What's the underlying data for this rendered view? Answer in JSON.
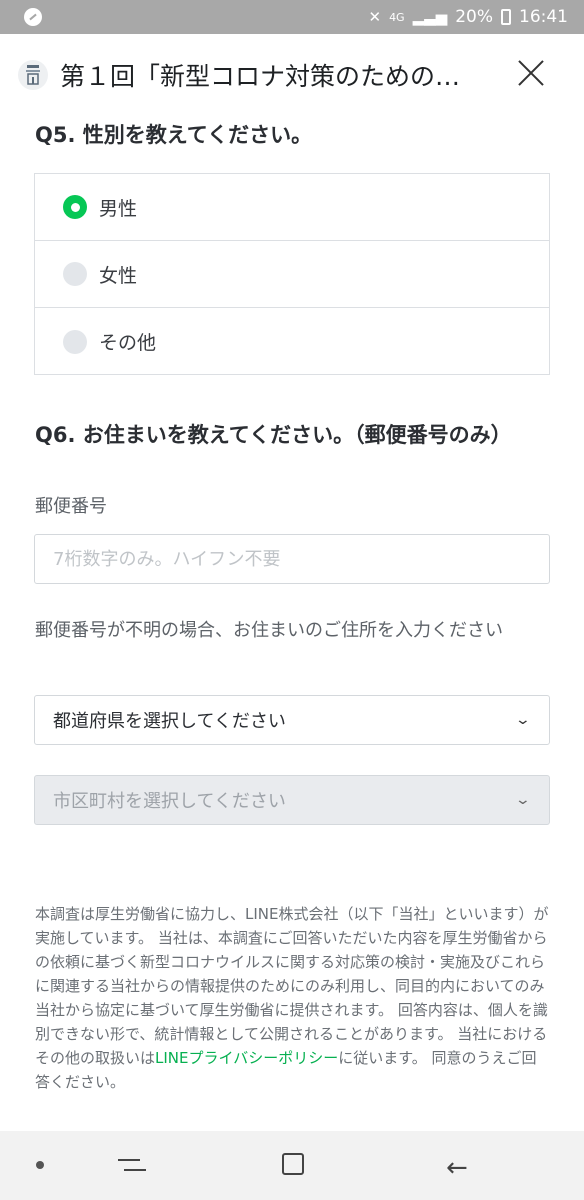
{
  "status_bar": {
    "network": "4G",
    "battery": "20%",
    "time": "16:41"
  },
  "header": {
    "title": "第１回「新型コロナ対策のための…"
  },
  "q5": {
    "title": "Q5. 性別を教えてください。",
    "options": [
      "男性",
      "女性",
      "その他"
    ],
    "selected": "男性"
  },
  "q6": {
    "title": "Q6. お住まいを教えてください。（郵便番号のみ）",
    "zip_label": "郵便番号",
    "zip_placeholder": "7桁数字のみ。ハイフン不要",
    "zip_value": "",
    "address_note": "郵便番号が不明の場合、お住まいのご住所を入力ください",
    "prefecture_select": "都道府県を選択してください",
    "city_select": "市区町村を選択してください"
  },
  "disclaimer": {
    "text_before_link": "本調査は厚生労働省に協力し、LINE株式会社（以下「当社」といいます）が実施しています。 当社は、本調査にご回答いただいた内容を厚生労働省からの依頼に基づく新型コロナウイルスに関する対応策の検討・実施及びこれらに関連する当社からの情報提供のためにのみ利用し、同目的内においてのみ当社から協定に基づいて厚生労働省に提供されます。 回答内容は、個人を識別できない形で、統計情報として公開されることがあります。 当社におけるその他の取扱いは",
    "link": "LINEプライバシーポリシー",
    "text_after_link": "に従います。 同意のうえご回答ください。"
  },
  "colors": {
    "accent_green": "#06c755",
    "status_bar": "#a8a8a8"
  }
}
